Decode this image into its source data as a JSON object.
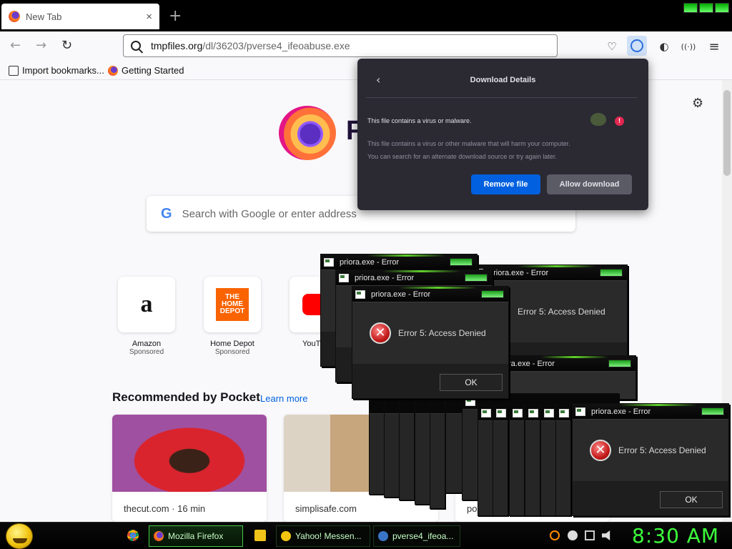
{
  "browser": {
    "tab_title": "New Tab",
    "tab_close": "×",
    "new_tab": "+",
    "url_host": "tmpfiles.org",
    "url_path": "/dl/36203/pverse4_ifeoabuse.exe",
    "bookmarks": [
      "Import bookmarks...",
      "Getting Started"
    ],
    "icons": {
      "back": "←",
      "forward": "→",
      "reload": "↻",
      "menu": "≡",
      "gear": "⚙"
    }
  },
  "newtab": {
    "brand_partial": "F",
    "search_placeholder": "Search with Google or enter address",
    "google_letter": "G",
    "shortcuts": [
      {
        "name": "Amazon",
        "sub": "Sponsored",
        "glyph": "a"
      },
      {
        "name": "Home Depot",
        "sub": "Sponsored",
        "glyph": "THE HOME DEPOT"
      },
      {
        "name": "YouT",
        "sub": ""
      }
    ],
    "pocket_heading": "Recommended by Pocket",
    "pocket_link": "Learn more",
    "cards": [
      {
        "source": "thecut.com · 16 min"
      },
      {
        "source": "simplisafe.com"
      },
      {
        "source": "po"
      }
    ]
  },
  "download_panel": {
    "title": "Download Details",
    "back_glyph": "‹",
    "warning": "This file contains a virus or malware.",
    "detail_line1": "This file contains a virus or other malware that will harm your computer.",
    "detail_line2": "You can search for an alternate download source or try again later.",
    "alert_glyph": "!",
    "remove_label": "Remove file",
    "allow_label": "Allow download"
  },
  "errors": {
    "window_title": "priora.exe - Error",
    "message": "Error 5: Access Denied",
    "ok_label": "OK",
    "x_glyph": "✕",
    "partial_title": "ora.exe - Error"
  },
  "taskbar": {
    "tasks": [
      {
        "label": "Mozilla Firefox",
        "active": true
      },
      {
        "label": "Yahoo! Messen...",
        "active": false
      },
      {
        "label": "pverse4_ifeoa...",
        "active": false
      }
    ],
    "clock": "8:30 AM"
  }
}
